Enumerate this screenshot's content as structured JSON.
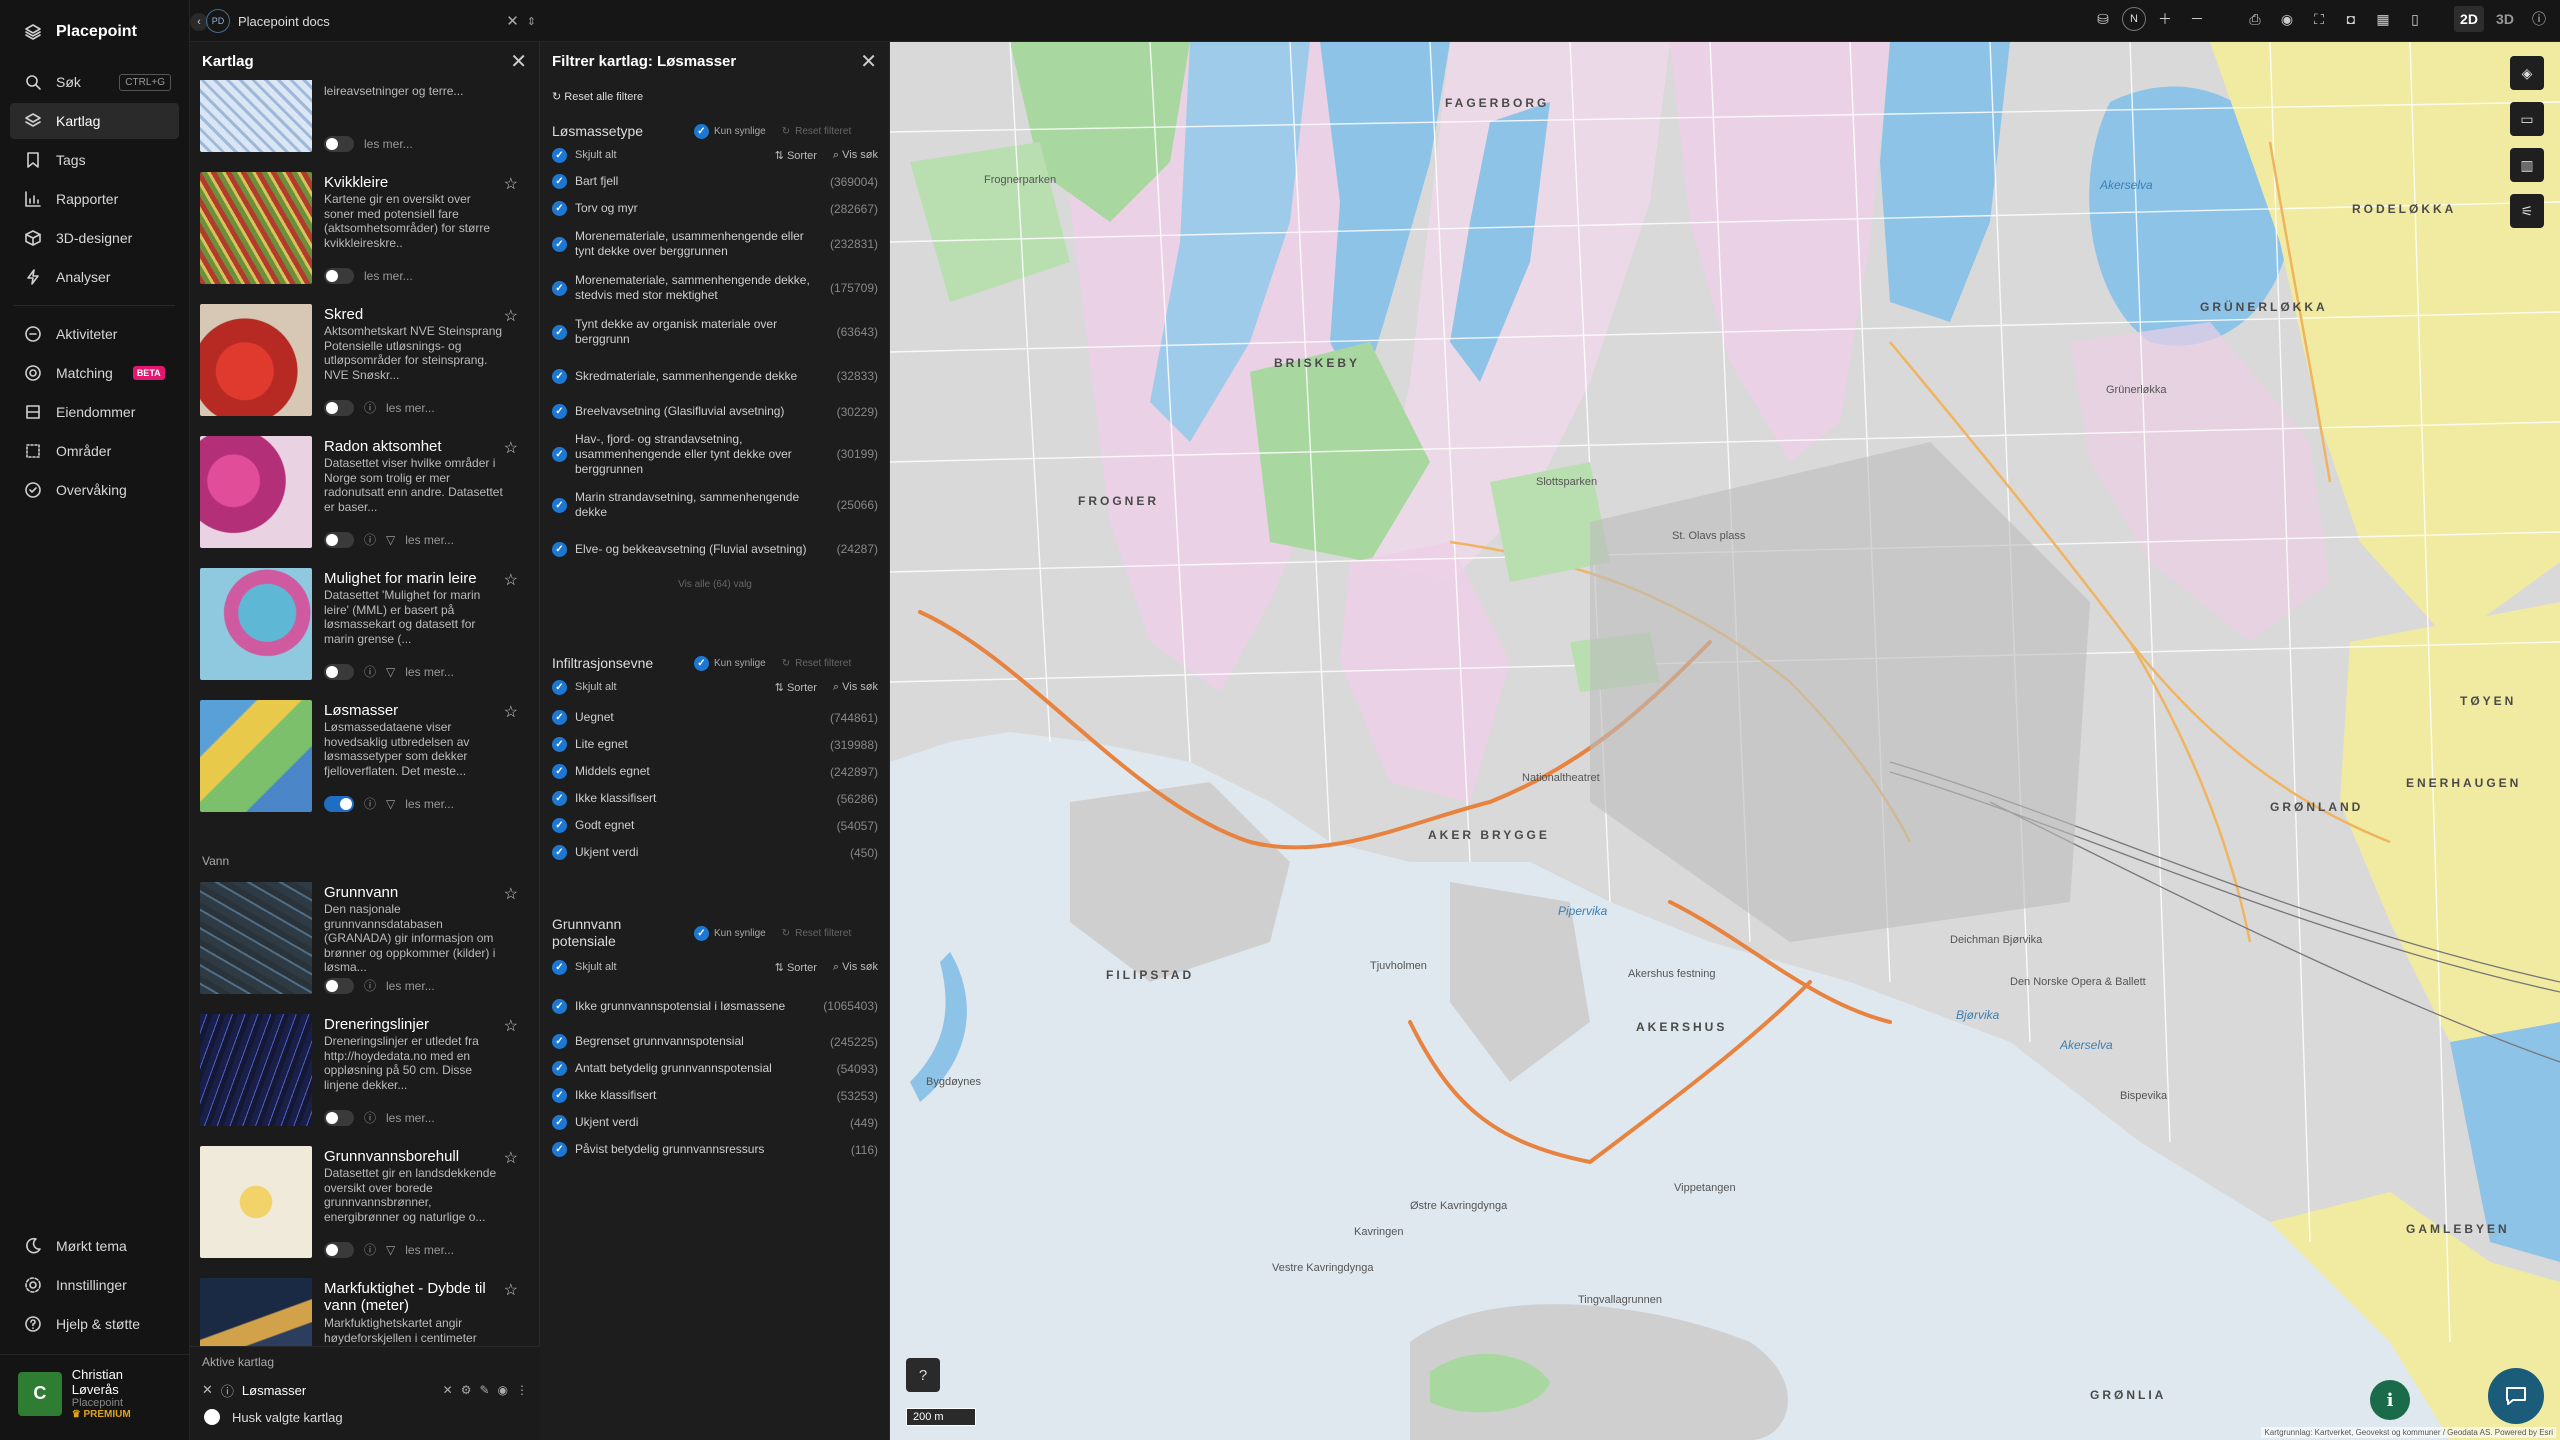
{
  "app": {
    "name": "Placepoint"
  },
  "nav": {
    "items": [
      {
        "label": "Søk",
        "shortcut": "CTRL+G",
        "icon": "search-icon"
      },
      {
        "label": "Kartlag",
        "icon": "layers-icon",
        "active": true
      },
      {
        "label": "Tags",
        "icon": "bookmark-icon"
      },
      {
        "label": "Rapporter",
        "icon": "chart-icon"
      },
      {
        "label": "3D-designer",
        "icon": "cube-icon"
      },
      {
        "label": "Analyser",
        "icon": "bolt-icon"
      }
    ],
    "items2": [
      {
        "label": "Aktiviteter",
        "icon": "activity-icon"
      },
      {
        "label": "Matching",
        "badge": "BETA",
        "icon": "matching-icon"
      },
      {
        "label": "Eiendommer",
        "icon": "property-icon"
      },
      {
        "label": "Områder",
        "icon": "area-icon"
      },
      {
        "label": "Overvåking",
        "icon": "monitor-icon"
      }
    ],
    "bottom": [
      {
        "label": "Mørkt tema",
        "icon": "moon-icon"
      },
      {
        "label": "Innstillinger",
        "icon": "gear-icon"
      },
      {
        "label": "Hjelp & støtte",
        "icon": "help-icon"
      }
    ],
    "user": {
      "initial": "C",
      "name": "Christian Løverås",
      "org": "Placepoint",
      "plan": "PREMIUM"
    }
  },
  "topbar": {
    "project_badge": "PD",
    "project": "Placepoint docs",
    "compass": "N",
    "mode_2d": "2D",
    "mode_3d": "3D"
  },
  "layers_panel": {
    "title": "Kartlag",
    "top_partial": {
      "desc": "leireavsetninger og terre..."
    },
    "read_more": "les mer...",
    "group_water": "Vann",
    "cards": [
      {
        "title": "Kvikkleire",
        "desc": "Kartene gir en oversikt over soner med potensiell fare (aktsomhetsområder) for større kvikkleireskre..",
        "on": false
      },
      {
        "title": "Skred",
        "desc": "Aktsomhetskart NVE Steinsprang Potensielle utløsnings- og utløpsområder for steinsprang. NVE Snøskr...",
        "on": false
      },
      {
        "title": "Radon aktsomhet",
        "desc": "Datasettet viser hvilke områder i Norge som trolig er mer radonutsatt enn andre. Datasettet er baser...",
        "on": false
      },
      {
        "title": "Mulighet for marin leire",
        "desc": "Datasettet 'Mulighet for marin leire' (MML) er basert på løsmassekart og datasett for marin grense (...",
        "on": false
      },
      {
        "title": "Løsmasser",
        "desc": "Løsmassedataene viser hovedsaklig utbredelsen av løsmassetyper som dekker fjelloverflaten. Det meste...",
        "on": true
      },
      {
        "title": "Grunnvann",
        "desc": "Den nasjonale grunnvannsdatabasen (GRANADA) gir informasjon om brønner og oppkommer (kilder) i løsma...",
        "on": false
      },
      {
        "title": "Dreneringslinjer",
        "desc": "Dreneringslinjer er utledet fra http://hoydedata.no med en oppløsning på 50 cm. Disse linjene dekker...",
        "on": false
      },
      {
        "title": "Grunnvannsborehull",
        "desc": "Datasettet gir en landsdekkende oversikt over borede grunnvannsbrønner, energibrønner og naturlige o...",
        "on": false
      },
      {
        "title": "Markfuktighet - Dybde til vann (meter)",
        "desc": "Markfuktighetskartet angir høydeforskjellen i centimeter mellom et punkt og nærmeste punkt som er be...",
        "on": false
      }
    ],
    "active_label": "Aktive kartlag",
    "active_layer": "Løsmasser",
    "keep_label": "Husk valgte kartlag"
  },
  "filter_panel": {
    "title": "Filtrer kartlag: Løsmasser",
    "reset_all": "Reset alle filtere",
    "only_visible": "Kun synlige",
    "reset_filter": "Reset filteret",
    "hide_all": "Skjult alt",
    "sort": "Sorter",
    "search": "Vis søk",
    "show_all": "Vis alle (64) valg",
    "sections": [
      {
        "name": "Løsmassetype",
        "rows": [
          {
            "label": "Bart fjell",
            "count": "(369004)"
          },
          {
            "label": "Torv og myr",
            "count": "(282667)"
          },
          {
            "label": "Morenemateriale, usammenhengende eller tynt dekke over berggrunnen",
            "count": "(232831)"
          },
          {
            "label": "Morenemateriale, sammenhengende dekke, stedvis med stor mektighet",
            "count": "(175709)"
          },
          {
            "label": "Tynt dekke av organisk materiale over berggrunn",
            "count": "(63643)"
          },
          {
            "label": "Skredmateriale, sammenhengende dekke",
            "count": "(32833)"
          },
          {
            "label": "Breelvavsetning (Glasifluvial avsetning)",
            "count": "(30229)"
          },
          {
            "label": "Hav-, fjord- og strandavsetning, usammenhengende eller tynt dekke over berggrunnen",
            "count": "(30199)"
          },
          {
            "label": "Marin strandavsetning, sammenhengende dekke",
            "count": "(25066)"
          },
          {
            "label": "Elve- og bekkeavsetning (Fluvial avsetning)",
            "count": "(24287)"
          }
        ]
      },
      {
        "name": "Infiltrasjonsevne",
        "rows": [
          {
            "label": "Uegnet",
            "count": "(744861)"
          },
          {
            "label": "Lite egnet",
            "count": "(319988)"
          },
          {
            "label": "Middels egnet",
            "count": "(242897)"
          },
          {
            "label": "Ikke klassifisert",
            "count": "(56286)"
          },
          {
            "label": "Godt egnet",
            "count": "(54057)"
          },
          {
            "label": "Ukjent verdi",
            "count": "(450)"
          }
        ]
      },
      {
        "name": "Grunnvann potensiale",
        "rows": [
          {
            "label": "Ikke grunnvannspotensial i løsmassene",
            "count": "(1065403)"
          },
          {
            "label": "Begrenset grunnvannspotensial",
            "count": "(245225)"
          },
          {
            "label": "Antatt betydelig grunnvannspotensial",
            "count": "(54093)"
          },
          {
            "label": "Ikke klassifisert",
            "count": "(53253)"
          },
          {
            "label": "Ukjent verdi",
            "count": "(449)"
          },
          {
            "label": "Påvist betydelig grunnvannsressurs",
            "count": "(116)"
          }
        ]
      }
    ]
  },
  "map": {
    "scale": "200 m",
    "attribution": "Kartgrunnlag: Kartverket, Geovekst og kommuner / Geodata AS. Powered by Esri",
    "labels": {
      "fagerborg": "FAGERBORG",
      "briskeby": "BRISKEBY",
      "frogner": "FROGNER",
      "grunerlokka": "GRÜNERLØKKA",
      "rodelokka": "RODELØKKA",
      "toyen": "TØYEN",
      "gronland": "GRØNLAND",
      "enerhaugen": "ENERHAUGEN",
      "akerbrygge": "AKER BRYGGE",
      "filipstad": "FILIPSTAD",
      "akershus": "AKERSHUS",
      "gamlebyen": "GAMLEBYEN",
      "gronlia": "GRØNLIA",
      "pipervika": "Pipervika",
      "bjorvika": "Bjørvika",
      "akerselva": "Akerselva",
      "frognerparken": "Frognerparken",
      "ostre": "Østre Kavringdynga",
      "vestre": "Vestre Kavringdynga",
      "kavringen": "Kavringen",
      "tingvallagrunnen": "Tingvallagrunnen",
      "slottsparken": "Slottsparken",
      "nationaltheatret": "Nationaltheatret",
      "stolavsplass": "St. Olavs plass",
      "bygdoynes": "Bygdøynes",
      "deichman": "Deichman Bjørvika",
      "operaen": "Den Norske Opera & Ballett",
      "gronlandplass": "Grünerløkka",
      "akershusfestning": "Akershus festning",
      "tjuvholmen": "Tjuvholmen",
      "bispevika": "Bispevika",
      "vippetangen": "Vippetangen"
    }
  }
}
